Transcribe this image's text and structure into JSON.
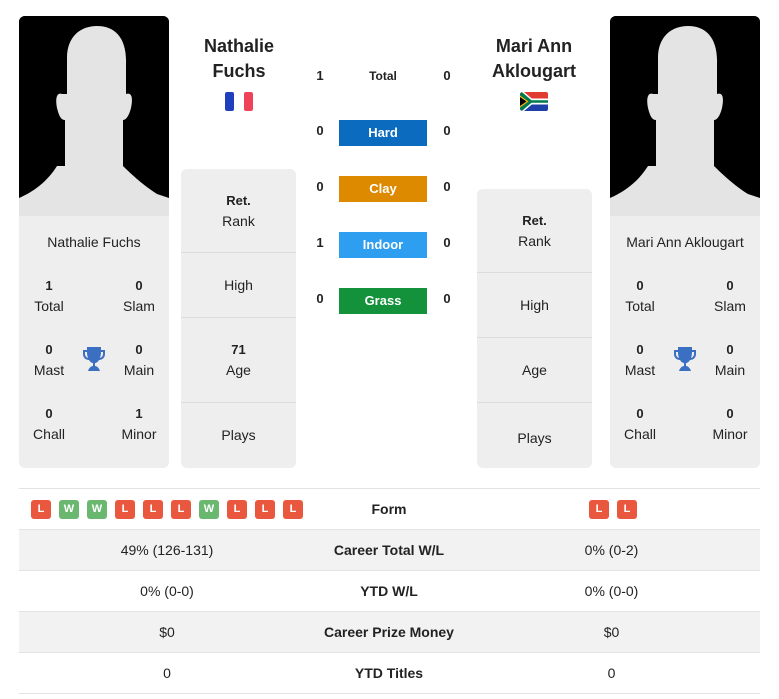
{
  "colors": {
    "hard": "#0a6bbf",
    "clay": "#dd8a00",
    "indoor": "#2e9ef0",
    "grass": "#13913b",
    "win": "#6ab870",
    "loss": "#e9573f",
    "trophy": "#3b6fc2"
  },
  "player_left": {
    "heading_first": "Nathalie",
    "heading_last": "Fuchs",
    "card_name": "Nathalie Fuchs",
    "flag": "france-flag",
    "titles": {
      "total": {
        "value": "1",
        "label": "Total"
      },
      "slam": {
        "value": "0",
        "label": "Slam"
      },
      "mast": {
        "value": "0",
        "label": "Mast"
      },
      "main": {
        "value": "0",
        "label": "Main"
      },
      "chall": {
        "value": "0",
        "label": "Chall"
      },
      "minor": {
        "value": "1",
        "label": "Minor"
      }
    },
    "info": {
      "rank_value": "Ret.",
      "rank_label": "Rank",
      "high_label": "High",
      "age_value": "71",
      "age_label": "Age",
      "plays_label": "Plays"
    }
  },
  "player_right": {
    "heading_first": "Mari Ann",
    "heading_last": "Aklougart",
    "card_name": "Mari Ann Aklougart",
    "flag": "south-africa-flag",
    "titles": {
      "total": {
        "value": "0",
        "label": "Total"
      },
      "slam": {
        "value": "0",
        "label": "Slam"
      },
      "mast": {
        "value": "0",
        "label": "Mast"
      },
      "main": {
        "value": "0",
        "label": "Main"
      },
      "chall": {
        "value": "0",
        "label": "Chall"
      },
      "minor": {
        "value": "0",
        "label": "Minor"
      }
    },
    "info": {
      "rank_value": "Ret.",
      "rank_label": "Rank",
      "high_label": "High",
      "age_label": "Age",
      "plays_label": "Plays"
    }
  },
  "h2h": [
    {
      "label": "Total",
      "left": "1",
      "right": "0",
      "surface": "total"
    },
    {
      "label": "Hard",
      "left": "0",
      "right": "0",
      "surface": "hard"
    },
    {
      "label": "Clay",
      "left": "0",
      "right": "0",
      "surface": "clay"
    },
    {
      "label": "Indoor",
      "left": "1",
      "right": "0",
      "surface": "indoor"
    },
    {
      "label": "Grass",
      "left": "0",
      "right": "0",
      "surface": "grass"
    }
  ],
  "comparison": {
    "form_label": "Form",
    "form_left": [
      "L",
      "W",
      "W",
      "L",
      "L",
      "L",
      "W",
      "L",
      "L",
      "L"
    ],
    "form_right": [
      "L",
      "L"
    ],
    "rows": [
      {
        "label": "Career Total W/L",
        "left": "49% (126-131)",
        "right": "0% (0-2)"
      },
      {
        "label": "YTD W/L",
        "left": "0% (0-0)",
        "right": "0% (0-0)"
      },
      {
        "label": "Career Prize Money",
        "left": "$0",
        "right": "$0"
      },
      {
        "label": "YTD Titles",
        "left": "0",
        "right": "0"
      }
    ]
  }
}
